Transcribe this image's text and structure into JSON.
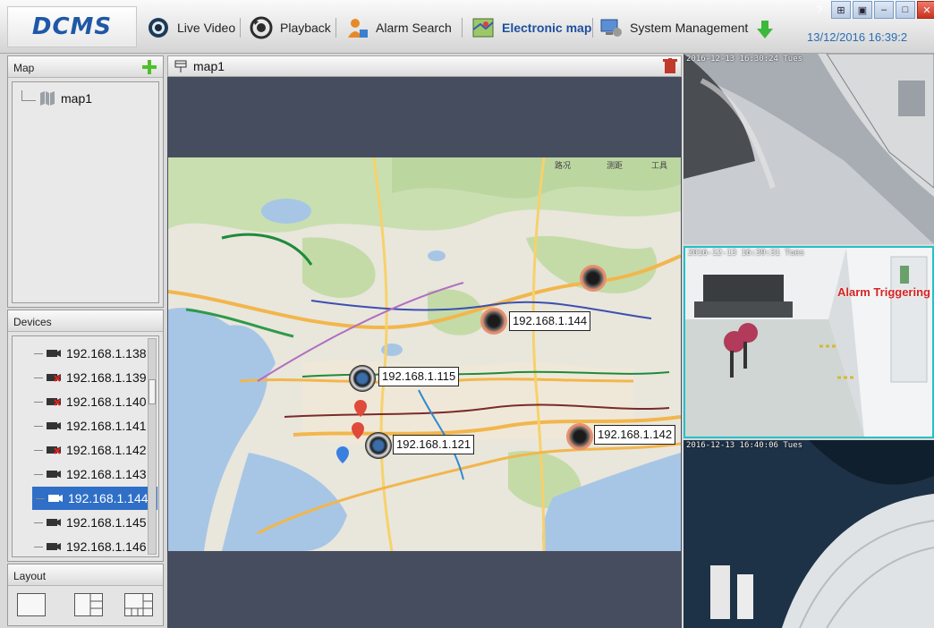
{
  "app": {
    "logo": "DCMS"
  },
  "nav": [
    {
      "label": "Live Video",
      "icon": "live-video-icon"
    },
    {
      "label": "Playback",
      "icon": "playback-icon"
    },
    {
      "label": "Alarm Search",
      "icon": "alarm-search-icon"
    },
    {
      "label": "Electronic map",
      "icon": "electronic-map-icon",
      "active": true
    },
    {
      "label": "System Management",
      "icon": "system-management-icon"
    }
  ],
  "clock": "13/12/2016 16:39:2",
  "map_panel": {
    "title": "Map",
    "items": [
      "map1"
    ]
  },
  "devices_panel": {
    "title": "Devices",
    "items": [
      {
        "ip": "192.168.1.138",
        "status": "online"
      },
      {
        "ip": "192.168.1.139",
        "status": "offline"
      },
      {
        "ip": "192.168.1.140",
        "status": "offline"
      },
      {
        "ip": "192.168.1.141",
        "status": "online"
      },
      {
        "ip": "192.168.1.142",
        "status": "offline"
      },
      {
        "ip": "192.168.1.143",
        "status": "online"
      },
      {
        "ip": "192.168.1.144",
        "status": "online",
        "selected": true
      },
      {
        "ip": "192.168.1.145",
        "status": "online"
      },
      {
        "ip": "192.168.1.146",
        "status": "online"
      }
    ]
  },
  "layout_panel": {
    "title": "Layout"
  },
  "map_view": {
    "title": "map1",
    "cameras": [
      {
        "ip": "192.168.1.144",
        "state": "alarm"
      },
      {
        "ip": "192.168.1.115",
        "state": "normal"
      },
      {
        "ip": "192.168.1.121",
        "state": "normal"
      },
      {
        "ip": "192.168.1.142",
        "state": "alarm"
      }
    ],
    "map_tools": [
      "路况",
      "测距",
      "工具"
    ]
  },
  "videos": [
    {
      "osd": "2016-12-13 16:30:24 Tues"
    },
    {
      "osd": "2016-12-13 16:39:31 Tues",
      "alarm": "Alarm Triggering"
    },
    {
      "osd": "2016-12-13 16:40:06 Tues"
    }
  ],
  "colors": {
    "accent": "#2f6fc7",
    "alarm": "#d72222",
    "active_frame": "#24c2c8",
    "map_bg": "#464d5e"
  }
}
